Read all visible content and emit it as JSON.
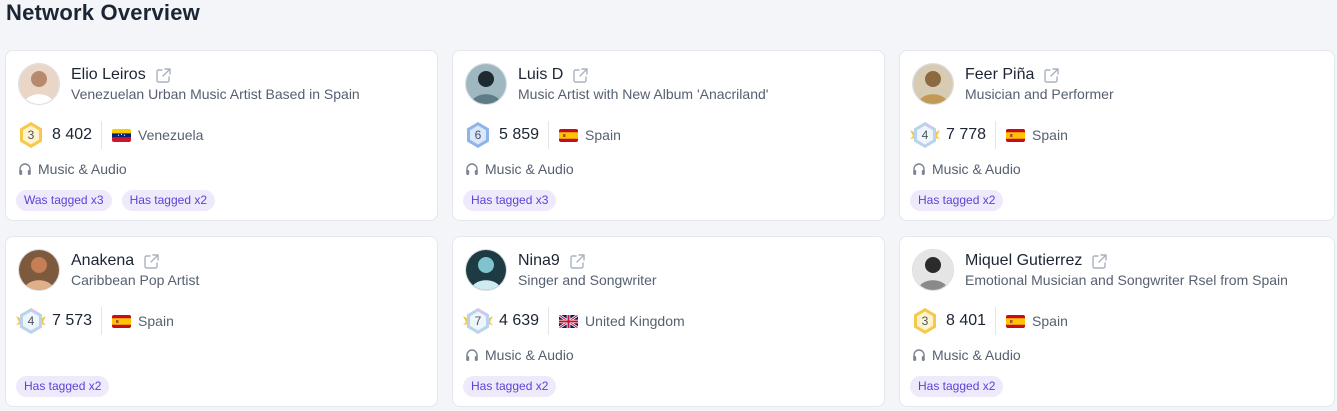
{
  "page": {
    "title": "Network Overview"
  },
  "colors": {
    "accent_tag_bg": "#eeeafc",
    "accent_tag_text": "#5b43d6",
    "card_border": "#e4e7ec",
    "page_bg": "#f3f5f8"
  },
  "cards": [
    {
      "name": "Elio Leiros",
      "description": "Venezuelan Urban Music Artist Based in Spain",
      "level": "3",
      "level_style": "gold",
      "score": "8 402",
      "country": "Venezuela",
      "flag": "venezuela",
      "category": "Music & Audio",
      "tags": [
        "Was tagged x3",
        "Has tagged x2"
      ]
    },
    {
      "name": "Luis D",
      "description": "Music Artist with New Album 'Anacriland'",
      "level": "6",
      "level_style": "blue",
      "score": "5 859",
      "country": "Spain",
      "flag": "spain",
      "category": "Music & Audio",
      "tags": [
        "Has tagged x3"
      ]
    },
    {
      "name": "Feer Piña",
      "description": "Musician and Performer",
      "level": "4",
      "level_style": "winged",
      "score": "7 778",
      "country": "Spain",
      "flag": "spain",
      "category": "Music & Audio",
      "tags": [
        "Has tagged x2"
      ]
    },
    {
      "name": "Anakena",
      "description": "Caribbean Pop Artist",
      "level": "4",
      "level_style": "winged",
      "score": "7 573",
      "country": "Spain",
      "flag": "spain",
      "category": "",
      "tags": [
        "Has tagged x2"
      ]
    },
    {
      "name": "Nina9",
      "description": "Singer and Songwriter",
      "level": "7",
      "level_style": "winged",
      "score": "4 639",
      "country": "United Kingdom",
      "flag": "uk",
      "category": "Music & Audio",
      "tags": [
        "Has tagged x2"
      ]
    },
    {
      "name": "Miquel Gutierrez",
      "description": "Emotional Musician and Songwriter Rsel from Spain",
      "level": "3",
      "level_style": "gold",
      "score": "8 401",
      "country": "Spain",
      "flag": "spain",
      "category": "Music & Audio",
      "tags": [
        "Has tagged x2"
      ]
    }
  ]
}
